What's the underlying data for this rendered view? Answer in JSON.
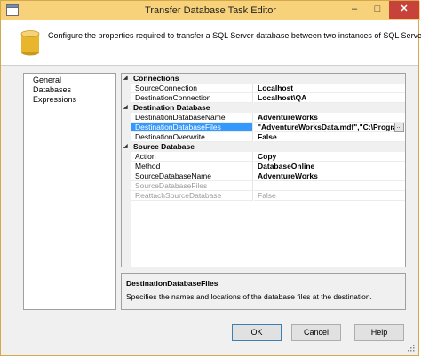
{
  "window": {
    "title": "Transfer Database Task Editor",
    "controls": {
      "minimize": "–",
      "maximize": "□",
      "close": "✕"
    },
    "colors": {
      "title_bar": "#f8d27a",
      "border": "#d4a94a",
      "close": "#c7423a",
      "selection": "#3399ff"
    }
  },
  "header": {
    "description": "Configure the properties required to transfer a SQL Server database between two instances of SQL Server."
  },
  "nav": {
    "items": [
      {
        "label": "General"
      },
      {
        "label": "Databases"
      },
      {
        "label": "Expressions"
      }
    ],
    "selected": "Databases"
  },
  "grid": {
    "categories": [
      {
        "name": "Connections",
        "toggle": "◢",
        "rows": [
          {
            "name": "SourceConnection",
            "value": "Localhost"
          },
          {
            "name": "DestinationConnection",
            "value": "Localhost\\QA"
          }
        ]
      },
      {
        "name": "Destination Database",
        "toggle": "◢",
        "rows": [
          {
            "name": "DestinationDatabaseName",
            "value": "AdventureWorks"
          },
          {
            "name": "DestinationDatabaseFiles",
            "value": "\"AdventureWorksData.mdf\",\"C:\\Program Fil",
            "selected": true
          },
          {
            "name": "DestinationOverwrite",
            "value": "False"
          }
        ]
      },
      {
        "name": "Source Database",
        "toggle": "◢",
        "rows": [
          {
            "name": "Action",
            "value": "Copy"
          },
          {
            "name": "Method",
            "value": "DatabaseOnline"
          },
          {
            "name": "SourceDatabaseName",
            "value": "AdventureWorks"
          },
          {
            "name": "SourceDatabaseFiles",
            "value": "",
            "disabled": true
          },
          {
            "name": "ReattachSourceDatabase",
            "value": "False",
            "disabled": true
          }
        ]
      }
    ],
    "ellipsis": "..."
  },
  "description_panel": {
    "title": "DestinationDatabaseFiles",
    "text": "Specifies the names and locations of the database files at the destination."
  },
  "buttons": {
    "ok": "OK",
    "cancel": "Cancel",
    "help": "Help"
  }
}
